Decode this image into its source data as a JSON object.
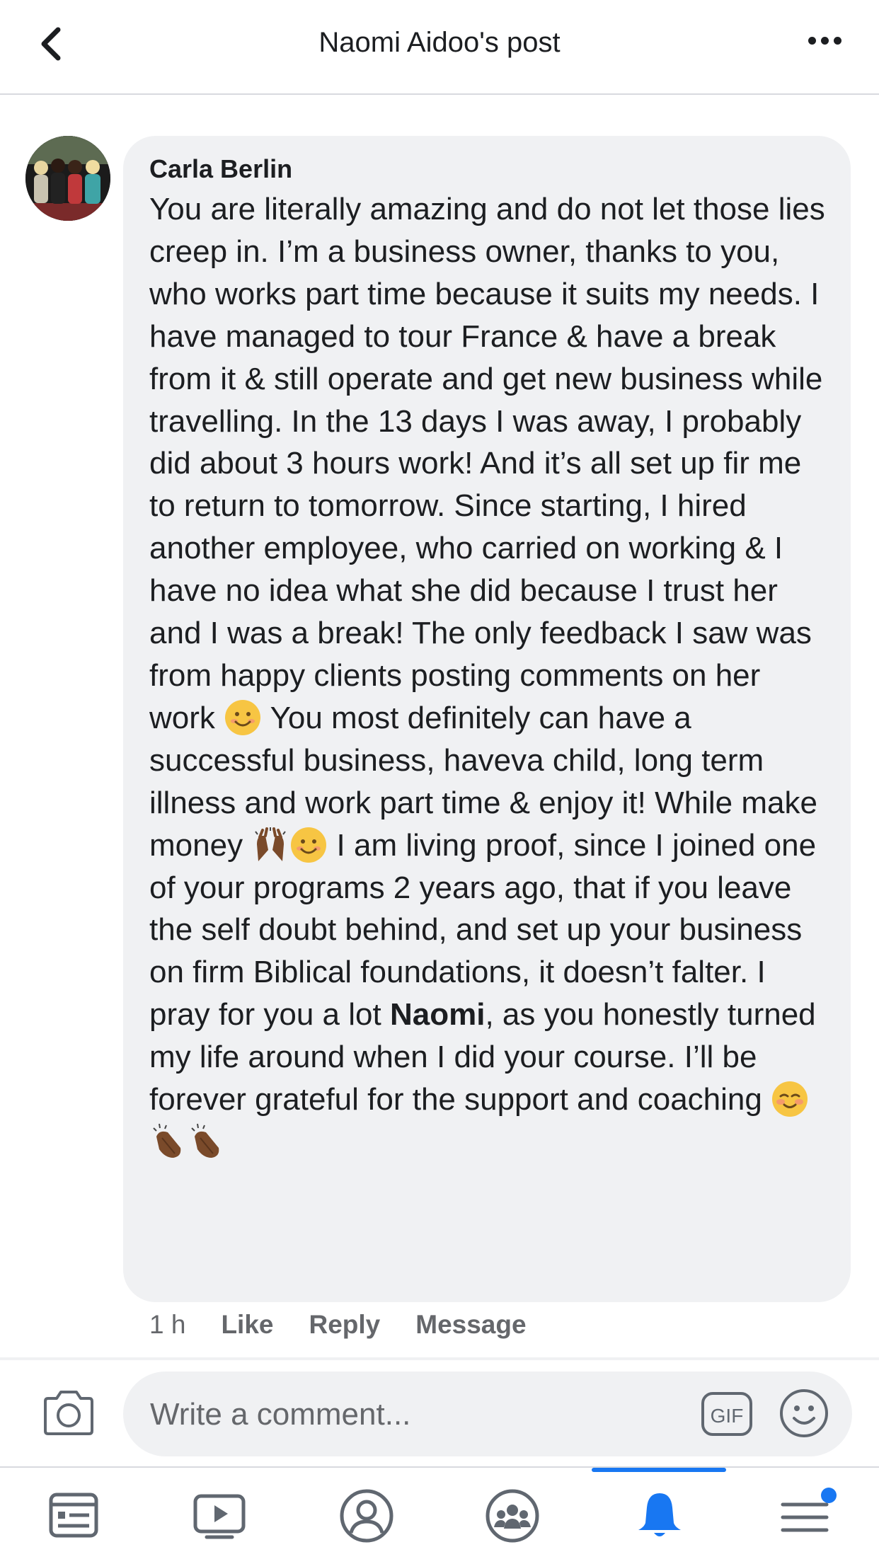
{
  "header": {
    "title": "Naomi Aidoo's post",
    "back_icon": "chevron-left-icon",
    "more_icon": "more-horizontal-icon"
  },
  "comment": {
    "author": "Carla Berlin",
    "text_parts": {
      "p1": "You are literally amazing and do not let those lies creep in. I’m a business owner, thanks to you, who works part time because it suits my needs. I have managed to tour France & have a break from it & still operate and get new business while travelling. In the 13 days I was away, I probably did about 3 hours work! And it’s all set up fir me to return to tomorrow. Since starting, I hired another employee, who carried on working & I have no idea what she did because I trust her and I was a break! The only feedback I saw was from happy clients posting comments on her work",
      "p2": "You most definitely can have a successful business, haveva child, long term illness and work part time & enjoy it! While make money",
      "p3": "I am living proof, since I joined one of your programs 2 years ago, that if you leave the self doubt behind, and set up your business on firm Biblical foundations, it doesn’t falter. I pray for you a lot",
      "mention": "Naomi",
      "p4": ", as you honestly turned my life around when I did your course. I’ll be forever grateful for the support and coaching"
    },
    "emojis": [
      "smiling-face-icon",
      "raising-hands-icon",
      "smiling-face-icon",
      "relieved-smile-icon",
      "clapping-hands-icon",
      "clapping-hands-icon"
    ],
    "time": "1 h",
    "actions": {
      "like": "Like",
      "reply": "Reply",
      "message": "Message"
    }
  },
  "composer": {
    "placeholder": "Write a comment...",
    "gif_label": "GIF",
    "camera_icon": "camera-icon",
    "emoji_icon": "emoji-icon"
  },
  "tabbar": {
    "tabs": [
      "news-feed-icon",
      "watch-icon",
      "profile-icon",
      "groups-icon",
      "notifications-icon",
      "menu-icon"
    ],
    "active": "notifications-icon",
    "accent": "#1877f2"
  }
}
